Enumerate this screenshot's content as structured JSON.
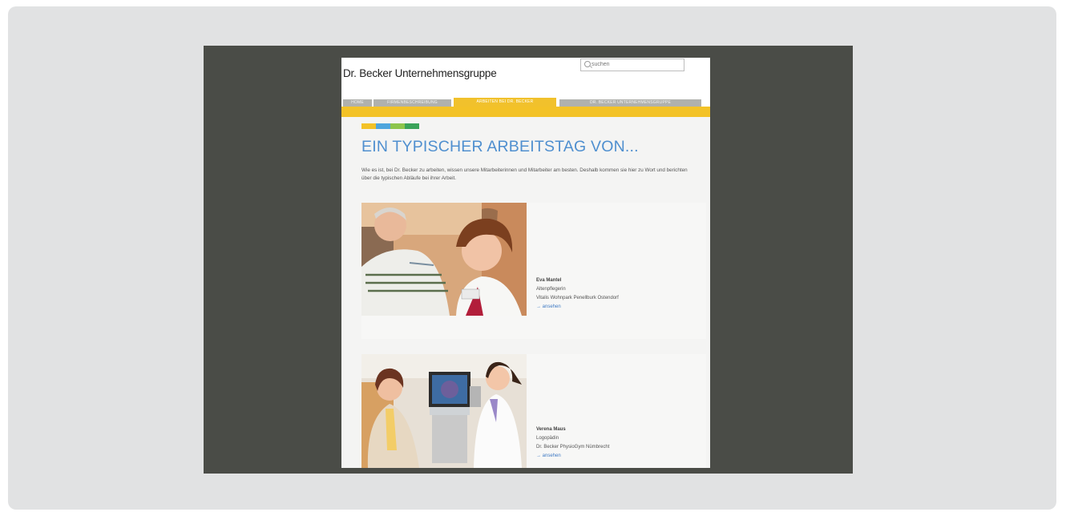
{
  "site": {
    "logo_text": "Dr. Becker Unternehmensgruppe",
    "search_placeholder": "suchen"
  },
  "nav": {
    "tabs": [
      {
        "label": "HOME",
        "active": false
      },
      {
        "label": "FIRMENBESCHREIBUNG",
        "active": false
      },
      {
        "label": "ARBEITEN BEI DR. BECKER",
        "active": true
      },
      {
        "label": "DR. BECKER UNTERNEHMENSGRUPPE",
        "active": false
      }
    ]
  },
  "colors": {
    "accent_yellow": "#f3c227",
    "heading_blue": "#4f8fcf",
    "bar_colors": [
      "#f3c227",
      "#4fa6dd",
      "#8dc54c",
      "#3aa35a"
    ]
  },
  "main": {
    "heading": "EIN TYPISCHER ARBEITSTAG VON...",
    "intro": "Wie es ist, bei Dr. Becker zu arbeiten, wissen unsere Mitarbeiterinnen und Mitarbeiter am besten. Deshalb kommen sie hier zu Wort und berichten über die typischen Abläufe bei ihrer Arbeit."
  },
  "profiles": [
    {
      "name": "Eva Mantel",
      "role": "Altenpflegerin",
      "location": "Vitalis Wohnpark Penellburk Ostendorf",
      "link": "→ ansehen",
      "photo": "portrait-older-man-and-nurse"
    },
    {
      "name": "Verena Maus",
      "role": "Logopädin",
      "location": "Dr. Becker PhysioGym Nümbrecht",
      "link": "→ ansehen",
      "photo": "two-women-at-medical-monitor"
    }
  ]
}
